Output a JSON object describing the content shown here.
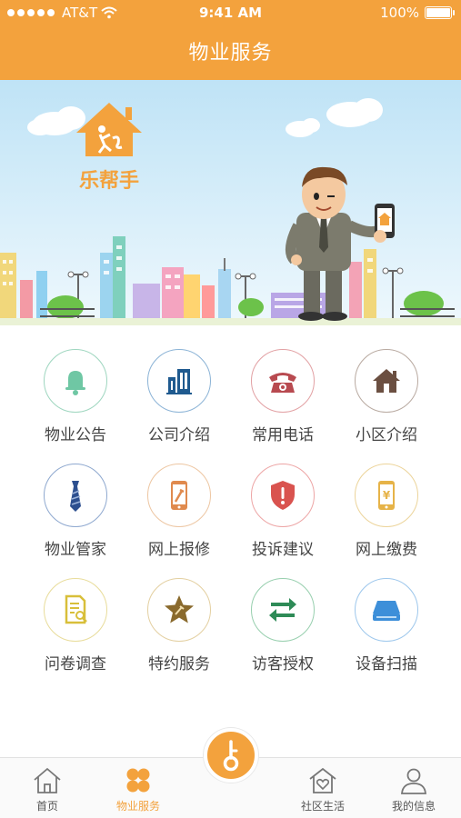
{
  "status_bar": {
    "carrier": "AT&T",
    "time": "9:41 AM",
    "battery": "100%"
  },
  "nav": {
    "title": "物业服务"
  },
  "banner": {
    "logo_text": "乐帮手"
  },
  "services": [
    {
      "label": "物业公告",
      "icon": "bell-icon"
    },
    {
      "label": "公司介绍",
      "icon": "building-icon"
    },
    {
      "label": "常用电话",
      "icon": "telephone-icon"
    },
    {
      "label": "小区介绍",
      "icon": "house-icon"
    },
    {
      "label": "物业管家",
      "icon": "tie-icon"
    },
    {
      "label": "网上报修",
      "icon": "repair-phone-icon"
    },
    {
      "label": "投诉建议",
      "icon": "shield-alert-icon"
    },
    {
      "label": "网上缴费",
      "icon": "yuan-phone-icon"
    },
    {
      "label": "问卷调查",
      "icon": "survey-document-icon"
    },
    {
      "label": "特约服务",
      "icon": "star-service-icon"
    },
    {
      "label": "访客授权",
      "icon": "swap-arrows-icon"
    },
    {
      "label": "设备扫描",
      "icon": "scanner-icon"
    }
  ],
  "tabbar": {
    "items": [
      {
        "label": "首页",
        "icon": "home-icon"
      },
      {
        "label": "物业服务",
        "icon": "clover-icon"
      },
      {
        "label": "社区生活",
        "icon": "heart-house-icon"
      },
      {
        "label": "我的信息",
        "icon": "person-icon"
      }
    ],
    "center_icon": "key-icon"
  },
  "colors": {
    "accent": "#f3a23d",
    "sky": "#cfe9f8",
    "text": "#444444"
  }
}
